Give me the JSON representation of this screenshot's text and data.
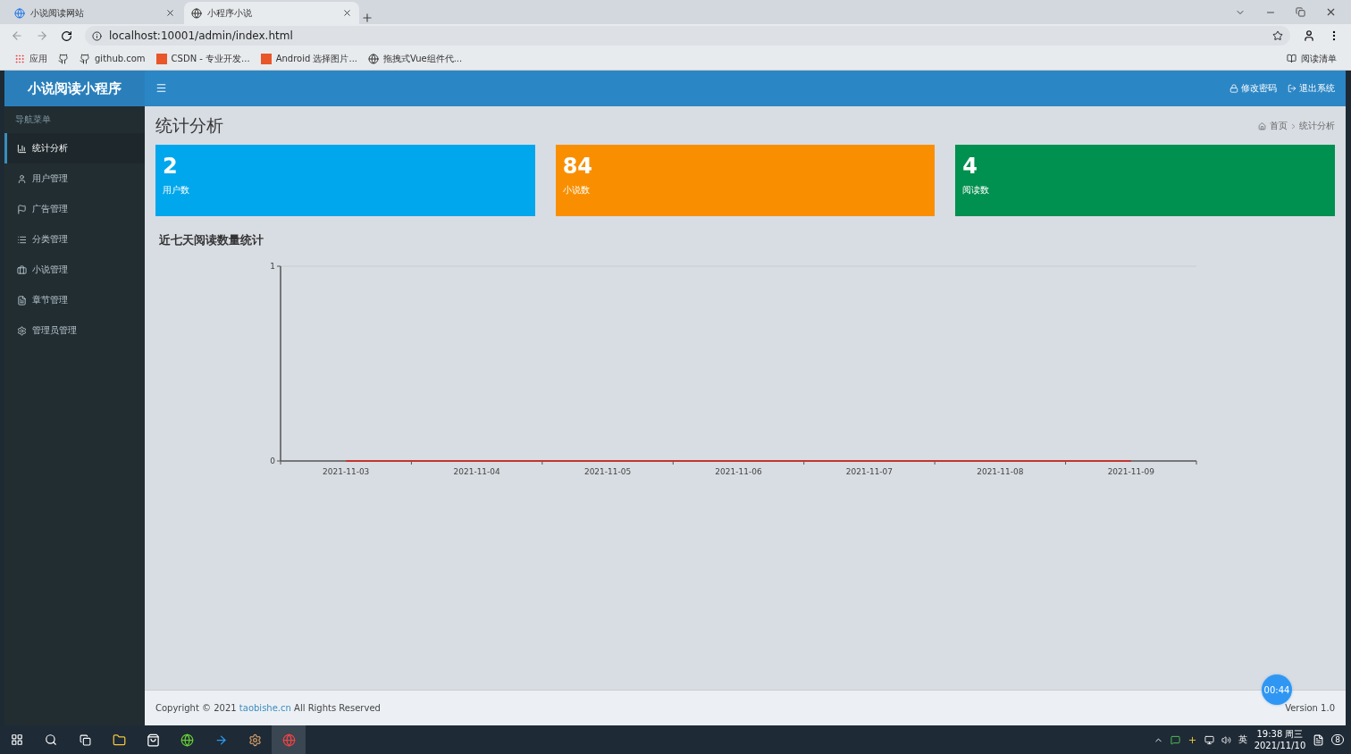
{
  "browser": {
    "tabs": [
      {
        "title": "小说阅读网站",
        "selected": false
      },
      {
        "title": "小程序小说",
        "selected": true
      }
    ],
    "address": "localhost:10001/admin/index.html",
    "bookmarks": [
      {
        "kind": "apps",
        "label": "应用"
      },
      {
        "kind": "github"
      },
      {
        "kind": "github",
        "label": "github.com"
      },
      {
        "kind": "csdn",
        "label": "CSDN - 专业开发..."
      },
      {
        "kind": "csdn",
        "label": "Android 选择图片..."
      },
      {
        "kind": "globe",
        "label": "拖拽式Vue组件代..."
      }
    ],
    "reading_list": "阅读清单"
  },
  "header": {
    "brand": "小说阅读小程序",
    "actions": [
      "修改密码",
      "退出系统"
    ]
  },
  "sidebar": {
    "heading": "导航菜单",
    "items": [
      {
        "label": "统计分析",
        "selected": true
      },
      {
        "label": "用户管理",
        "selected": false
      },
      {
        "label": "广告管理",
        "selected": false
      },
      {
        "label": "分类管理",
        "selected": false
      },
      {
        "label": "小说管理",
        "selected": false
      },
      {
        "label": "章节管理",
        "selected": false
      },
      {
        "label": "管理员管理",
        "selected": false
      }
    ]
  },
  "page_title": "统计分析",
  "breadcrumb": [
    "首页",
    "统计分析"
  ],
  "stats": [
    {
      "value": "2",
      "label": "用户数",
      "color": "#00a7ec"
    },
    {
      "value": "84",
      "label": "小说数",
      "color": "#f98f00"
    },
    {
      "value": "4",
      "label": "阅读数",
      "color": "#00904f"
    }
  ],
  "chart_section": {
    "title": "近七天阅读数量统计",
    "chart_data": {
      "type": "line",
      "categories": [
        "2021-11-03",
        "2021-11-04",
        "2021-11-05",
        "2021-11-06",
        "2021-11-07",
        "2021-11-08",
        "2021-11-09"
      ],
      "ylim": [
        0,
        1
      ],
      "yticks": [
        0,
        1
      ],
      "series": [
        {
          "color": "#c23531",
          "values": [
            0,
            0,
            0,
            0,
            0,
            0,
            0
          ]
        }
      ]
    }
  },
  "footer": {
    "prefix": "Copyright © 2021",
    "link": "taobishe.cn",
    "suffix": "All Rights Reserved",
    "version": "Version 1.0"
  },
  "timer": "00:44",
  "taskbar": {
    "ime": "英",
    "time": "19:38 周三",
    "date": "2021/11/10",
    "notifications": "8"
  }
}
